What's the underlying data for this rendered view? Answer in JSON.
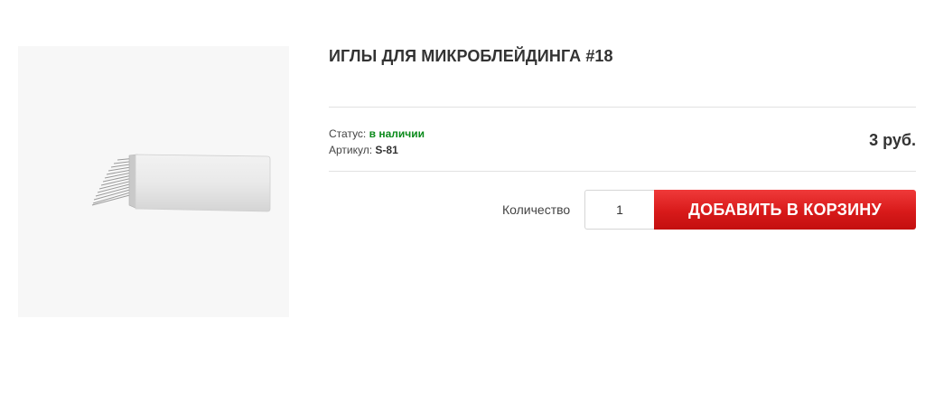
{
  "product": {
    "title": "ИГЛЫ ДЛЯ МИКРОБЛЕЙДИНГА #18",
    "image_alt": "Игла для микроблейдинга",
    "status_label": "Статус:",
    "status_value": "в наличии",
    "sku_label": "Артикул:",
    "sku_value": "S-81",
    "price": "3 руб."
  },
  "cart": {
    "quantity_label": "Количество",
    "quantity_value": "1",
    "add_button_label": "ДОБАВИТЬ В КОРЗИНУ"
  },
  "colors": {
    "accent_button": "#d81a1a",
    "status_in_stock": "#0a8a1a",
    "text": "#333333"
  },
  "icons": {
    "product_image": "microblading-needle-image"
  }
}
